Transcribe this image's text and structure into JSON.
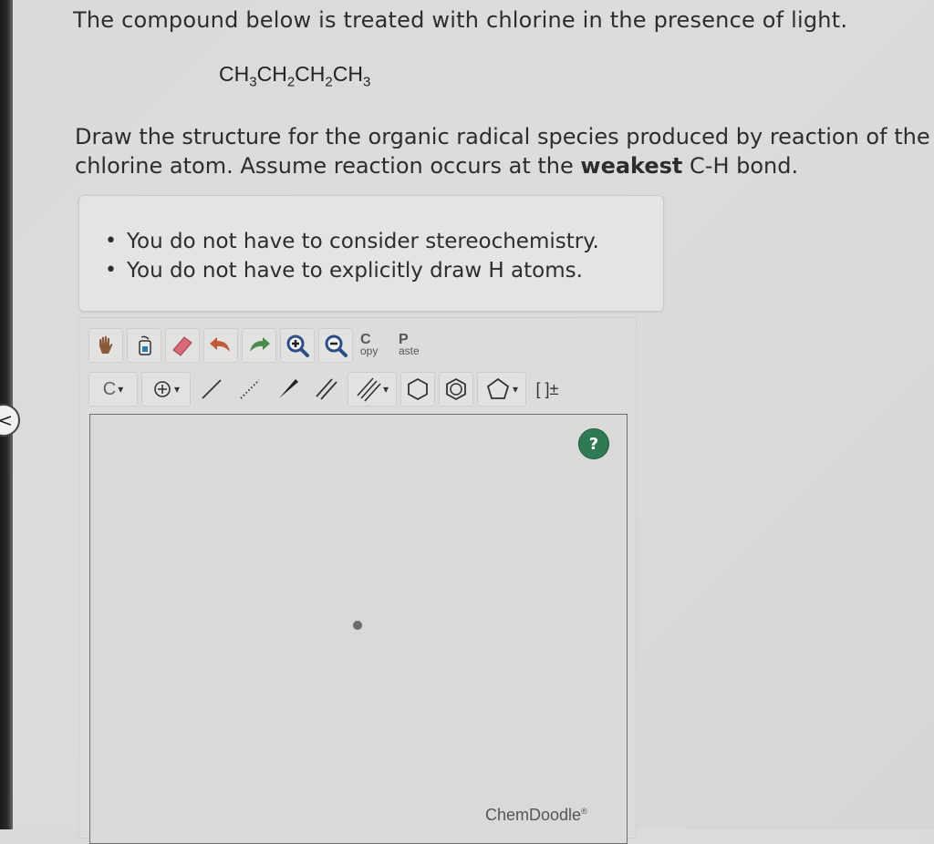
{
  "question": {
    "line1": "The compound below is treated with chlorine in the presence of light.",
    "formula_parts": [
      "CH",
      "3",
      "CH",
      "2",
      "CH",
      "2",
      "CH",
      "3"
    ],
    "line2": "Draw the structure for the organic radical species produced by reaction of the",
    "line3_pre": "chlorine atom. Assume reaction occurs at the ",
    "line3_bold": "weakest",
    "line3_post": " C-H bond."
  },
  "hints": [
    "You do not have to consider stereochemistry.",
    "You do not have to explicitly draw H atoms."
  ],
  "toolbar": {
    "copy_top": "C",
    "copy_bottom": "opy",
    "paste_top": "P",
    "paste_bottom": "aste",
    "element_selected": "C",
    "charge_label": "[ ]±",
    "dropdown_glyph": "▾"
  },
  "canvas": {
    "help_label": "?",
    "brand": "ChemDoodle",
    "brand_mark": "®"
  },
  "nav": {
    "back_glyph": "<"
  },
  "colors": {
    "help_button": "#2f7a55",
    "hand_tool": "#8a5a3c",
    "eraser": "#d96a7a",
    "undo_arrow": "#c25a3c",
    "redo_arrow": "#4d8a4d",
    "zoom": "#2c4e86"
  }
}
